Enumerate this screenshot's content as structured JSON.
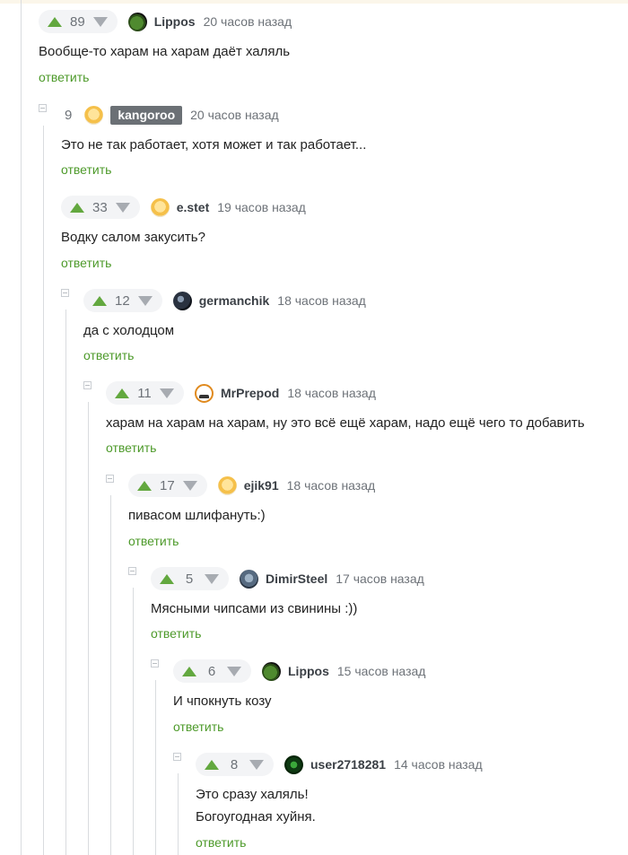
{
  "comments": [
    {
      "rating": "89",
      "username": "Lippos",
      "time": "20 часов назад",
      "avatar": "frog-avatar",
      "lines": [
        "Вообще-то харам на харам даёт халяль"
      ]
    },
    {
      "rating": "9",
      "username": "kangoroo",
      "time": "20 часов назад",
      "avatar": "emoji-avatar",
      "lines": [
        "Это не так работает, хотя может и так работает..."
      ]
    },
    {
      "rating": "33",
      "username": "e.stet",
      "time": "19 часов назад",
      "avatar": "emoji-avatar",
      "lines": [
        "Водку салом закусить?"
      ]
    },
    {
      "rating": "12",
      "username": "germanchik",
      "time": "18 часов назад",
      "avatar": "dark-avatar",
      "lines": [
        "да с холодцом"
      ]
    },
    {
      "rating": "11",
      "username": "MrPrepod",
      "time": "18 часов назад",
      "avatar": "prepod-avatar",
      "lines": [
        "харам на харам на харам, ну это всё ещё харам, надо ещё чего то добавить"
      ]
    },
    {
      "rating": "17",
      "username": "ejik91",
      "time": "18 часов назад",
      "avatar": "emoji-avatar",
      "lines": [
        "пивасом шлифануть:)"
      ]
    },
    {
      "rating": "5",
      "username": "DimirSteel",
      "time": "17 часов назад",
      "avatar": "steel-avatar",
      "lines": [
        "Мясными чипсами из свинины :))"
      ]
    },
    {
      "rating": "6",
      "username": "Lippos",
      "time": "15 часов назад",
      "avatar": "frog-avatar",
      "lines": [
        "И чпокнуть козу"
      ]
    },
    {
      "rating": "8",
      "username": "user2718281",
      "time": "14 часов назад",
      "avatar": "clover-avatar",
      "lines": [
        "Это сразу халяль!",
        "Богоугодная хуйня."
      ]
    }
  ],
  "reply_label": "ответить",
  "colors": {
    "accent_green": "#4d9a2a",
    "upvote": "#63a83f",
    "downvote": "#a7abb1",
    "badge_bg": "#6b7075"
  }
}
